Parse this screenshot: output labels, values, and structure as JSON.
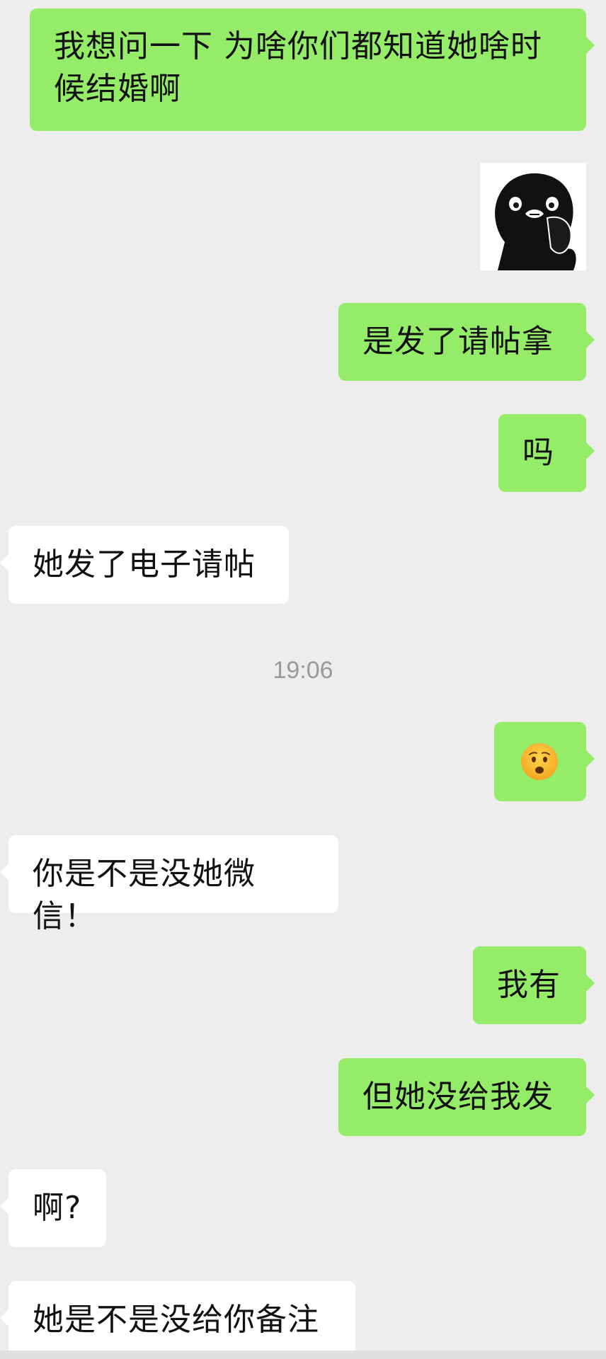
{
  "messages": [
    {
      "text": "我想问一下 为啥你们都知道她啥时\n候结婚啊"
    },
    {
      "sticker": "penguin-sticker"
    },
    {
      "text": "是发了请帖拿"
    },
    {
      "text": "吗"
    },
    {
      "text": "她发了电子请帖"
    },
    {
      "time": "19:06"
    },
    {
      "emoji": "worried-face-emoji"
    },
    {
      "text": "你是不是没她微信！"
    },
    {
      "text": "我有"
    },
    {
      "text": "但她没给我发"
    },
    {
      "text": "啊?"
    },
    {
      "text": "她是不是没给你备注"
    }
  ],
  "colors": {
    "background": "#ededed",
    "outgoing_bubble": "#95ec69",
    "incoming_bubble": "#ffffff",
    "timestamp": "#9a9a9a"
  }
}
